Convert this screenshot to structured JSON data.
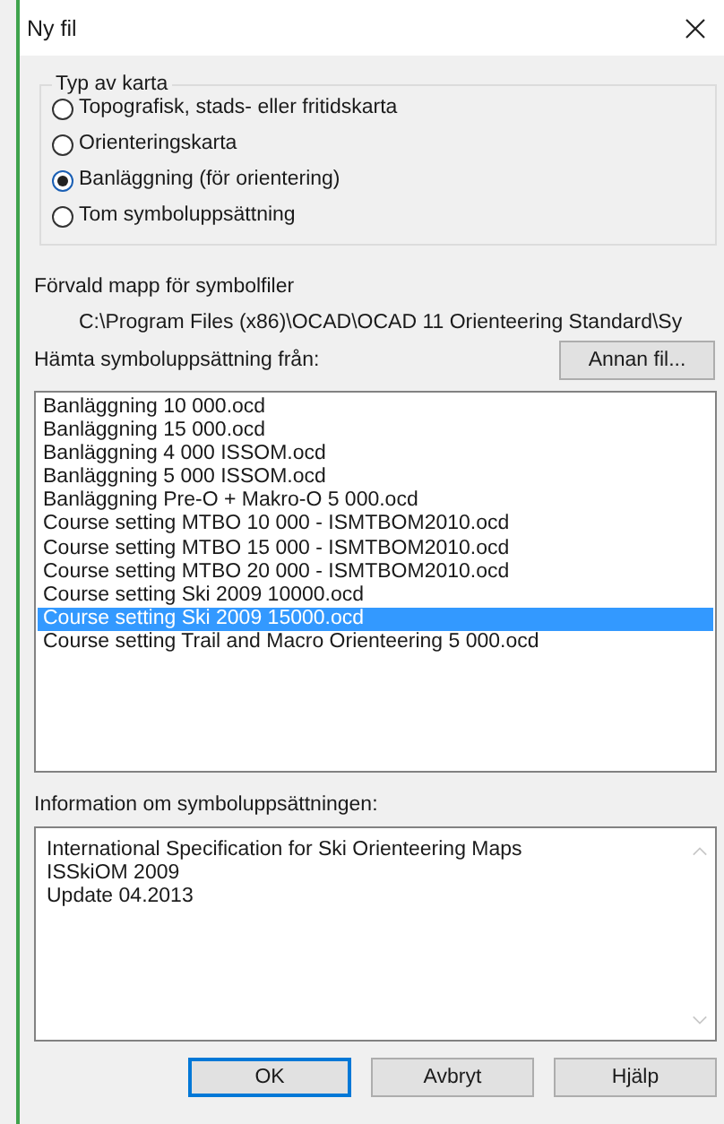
{
  "window": {
    "title": "Ny fil"
  },
  "map_type": {
    "title": "Typ av karta",
    "options": [
      {
        "label": "Topografisk, stads- eller fritidskarta",
        "selected": false
      },
      {
        "label": "Orienteringskarta",
        "selected": false
      },
      {
        "label": "Banläggning (för orientering)",
        "selected": true
      },
      {
        "label": "Tom symboluppsättning",
        "selected": false
      }
    ]
  },
  "default_folder": {
    "label": "Förvald mapp för symbolfiler",
    "path": "C:\\Program Files (x86)\\OCAD\\OCAD 11 Orienteering Standard\\Sy"
  },
  "load_from": {
    "label": "Hämta symboluppsättning från:",
    "button": "Annan fil..."
  },
  "files": [
    {
      "name": "Banläggning 10 000.ocd",
      "selected": false
    },
    {
      "name": "Banläggning 15 000.ocd",
      "selected": false
    },
    {
      "name": "Banläggning 4 000 ISSOM.ocd",
      "selected": false
    },
    {
      "name": "Banläggning 5 000 ISSOM.ocd",
      "selected": false
    },
    {
      "name": "Banläggning Pre-O + Makro-O 5 000.ocd",
      "selected": false
    },
    {
      "name": "Course setting MTBO 10 000 - ISMTBOM2010.ocd",
      "selected": false
    },
    {
      "name": "Course setting MTBO 15 000 - ISMTBOM2010.ocd",
      "selected": false
    },
    {
      "name": "Course setting MTBO 20 000 - ISMTBOM2010.ocd",
      "selected": false
    },
    {
      "name": "Course setting Ski 2009 10000.ocd",
      "selected": false
    },
    {
      "name": "Course setting Ski 2009 15000.ocd",
      "selected": true
    },
    {
      "name": "Course setting Trail and Macro Orienteering 5 000.ocd",
      "selected": false
    }
  ],
  "info": {
    "label": "Information om symboluppsättningen:",
    "lines": [
      "International Specification for Ski Orienteering Maps",
      "ISSkiOM 2009",
      "Update 04.2013"
    ]
  },
  "buttons": [
    {
      "label": "OK",
      "default": true
    },
    {
      "label": "Avbryt",
      "default": false
    },
    {
      "label": "Hjälp",
      "default": false
    }
  ]
}
